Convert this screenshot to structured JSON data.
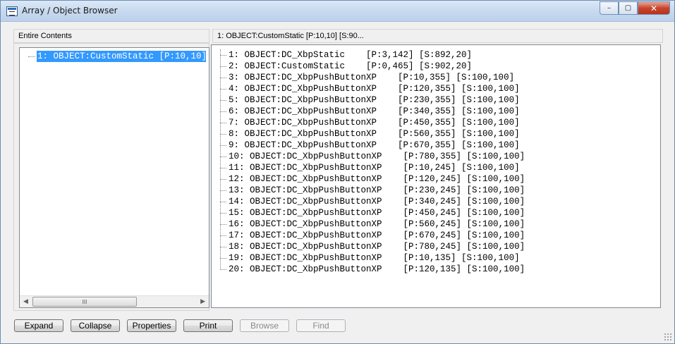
{
  "window": {
    "title": "Array / Object Browser",
    "icon": "app-window-icon",
    "controls": {
      "minimize": "–",
      "restore": "▢",
      "close": "✕"
    }
  },
  "left_pane": {
    "header": "Entire Contents",
    "tree": [
      {
        "label": "1: OBJECT:CustomStatic    [P:10,10] [S:90...",
        "selected": true
      }
    ]
  },
  "right_pane": {
    "header": "1: OBJECT:CustomStatic   [P:10,10] [S:90...",
    "items": [
      "1: OBJECT:DC_XbpStatic    [P:3,142] [S:892,20]",
      "2: OBJECT:CustomStatic    [P:0,465] [S:902,20]",
      "3: OBJECT:DC_XbpPushButtonXP    [P:10,355] [S:100,100]",
      "4: OBJECT:DC_XbpPushButtonXP    [P:120,355] [S:100,100]",
      "5: OBJECT:DC_XbpPushButtonXP    [P:230,355] [S:100,100]",
      "6: OBJECT:DC_XbpPushButtonXP    [P:340,355] [S:100,100]",
      "7: OBJECT:DC_XbpPushButtonXP    [P:450,355] [S:100,100]",
      "8: OBJECT:DC_XbpPushButtonXP    [P:560,355] [S:100,100]",
      "9: OBJECT:DC_XbpPushButtonXP    [P:670,355] [S:100,100]",
      "10: OBJECT:DC_XbpPushButtonXP    [P:780,355] [S:100,100]",
      "11: OBJECT:DC_XbpPushButtonXP    [P:10,245] [S:100,100]",
      "12: OBJECT:DC_XbpPushButtonXP    [P:120,245] [S:100,100]",
      "13: OBJECT:DC_XbpPushButtonXP    [P:230,245] [S:100,100]",
      "14: OBJECT:DC_XbpPushButtonXP    [P:340,245] [S:100,100]",
      "15: OBJECT:DC_XbpPushButtonXP    [P:450,245] [S:100,100]",
      "16: OBJECT:DC_XbpPushButtonXP    [P:560,245] [S:100,100]",
      "17: OBJECT:DC_XbpPushButtonXP    [P:670,245] [S:100,100]",
      "18: OBJECT:DC_XbpPushButtonXP    [P:780,245] [S:100,100]",
      "19: OBJECT:DC_XbpPushButtonXP    [P:10,135] [S:100,100]",
      "20: OBJECT:DC_XbpPushButtonXP    [P:120,135] [S:100,100]"
    ]
  },
  "buttons": {
    "expand": {
      "label": "Expand",
      "enabled": true
    },
    "collapse": {
      "label": "Collapse",
      "enabled": true
    },
    "properties": {
      "label": "Properties",
      "enabled": true
    },
    "print": {
      "label": "Print",
      "enabled": true
    },
    "browse": {
      "label": "Browse",
      "enabled": false
    },
    "find": {
      "label": "Find",
      "enabled": false
    }
  },
  "scrollbar": {
    "left_arrow": "◀",
    "right_arrow": "▶",
    "grip": "III"
  },
  "colors": {
    "selection": "#3399ff",
    "titlebar": "#c8daef",
    "close_button": "#c7452d"
  }
}
